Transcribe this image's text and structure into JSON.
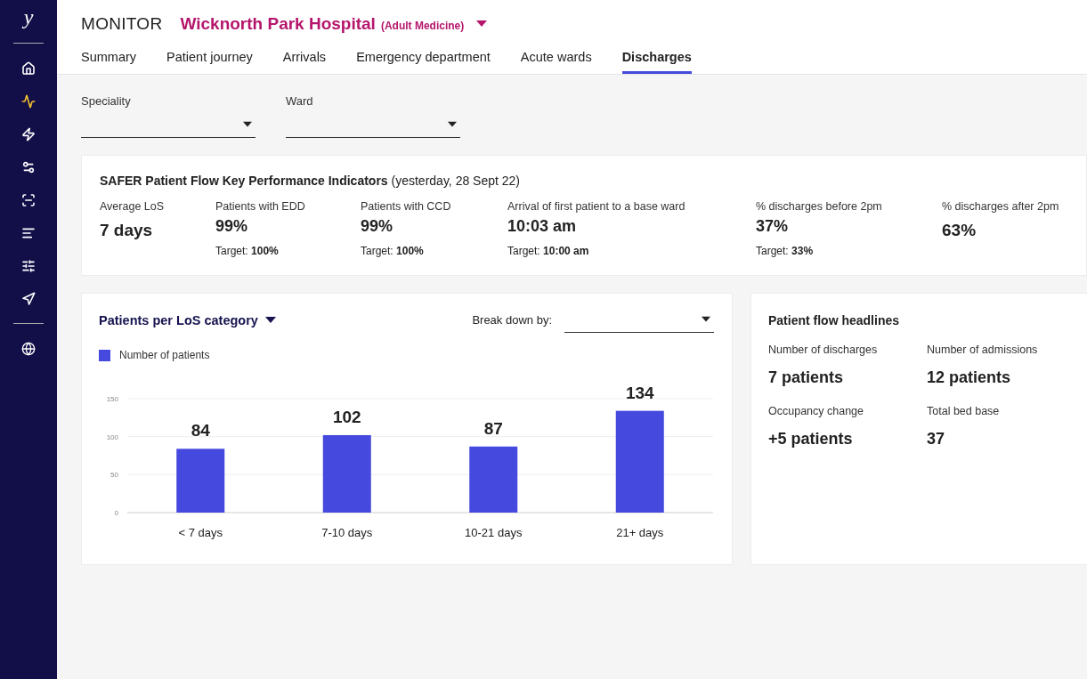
{
  "sidebar": {
    "logo": "y",
    "items": [
      {
        "selected": false
      },
      {
        "selected": true
      },
      {
        "selected": false
      },
      {
        "selected": false
      },
      {
        "selected": false
      },
      {
        "selected": false
      },
      {
        "selected": false
      },
      {
        "selected": false
      }
    ],
    "footer_items": [
      {
        "selected": false
      }
    ]
  },
  "header": {
    "app_name": "MONITOR",
    "hospital": "Wicknorth Park Hospital",
    "department": "(Adult Medicine)"
  },
  "tabs": [
    {
      "label": "Summary",
      "selected": false
    },
    {
      "label": "Patient journey",
      "selected": false
    },
    {
      "label": "Arrivals",
      "selected": false
    },
    {
      "label": "Emergency department",
      "selected": false
    },
    {
      "label": "Acute wards",
      "selected": false
    },
    {
      "label": "Discharges",
      "selected": true
    }
  ],
  "filters": [
    {
      "label": "Speciality"
    },
    {
      "label": "Ward"
    }
  ],
  "kpi_panel": {
    "title": "**SAFER Patient Flow Key Performance Indicators** (yesterday, 28 Sept 22)",
    "items": [
      {
        "label": "Average LoS",
        "value": "7 days"
      },
      {
        "label": "Patients with EDD",
        "value": "99%",
        "target": "Target: **100%**"
      },
      {
        "label": "Patients with CCD",
        "value": "99%",
        "target": "Target: **100%**"
      },
      {
        "label": "Arrival of first patient to a base ward",
        "value": "10:03 am",
        "target": "Target: **10:00 am**"
      },
      {
        "label": "% discharges before 2pm",
        "value": "37%",
        "target": "Target: **33%**"
      },
      {
        "label": "% discharges after 2pm",
        "value": "63%"
      }
    ]
  },
  "los_chart": {
    "title": "Patients per LoS category",
    "breakdown_label": "Break down by:",
    "chart_data": {
      "type": "bar",
      "categories": [
        "< 7 days",
        "7-10 days",
        "10-21 days",
        "21+ days"
      ],
      "series": [
        {
          "name": "Number of patients",
          "color": "#4549dd",
          "values": [
            84,
            102,
            87,
            134
          ]
        }
      ],
      "ylim": [
        0,
        150
      ],
      "yticks": [
        0,
        50,
        100,
        150
      ],
      "data_labels": true
    }
  },
  "headlines": {
    "title": "Patient flow headlines",
    "items": [
      {
        "label": "Number of discharges",
        "value": "7 patients"
      },
      {
        "label": "Number of admissions",
        "value": "12 patients"
      },
      {
        "label": "Occupancy change",
        "value": "+5 patients"
      },
      {
        "label": "Total bed base",
        "value": "37"
      }
    ]
  }
}
